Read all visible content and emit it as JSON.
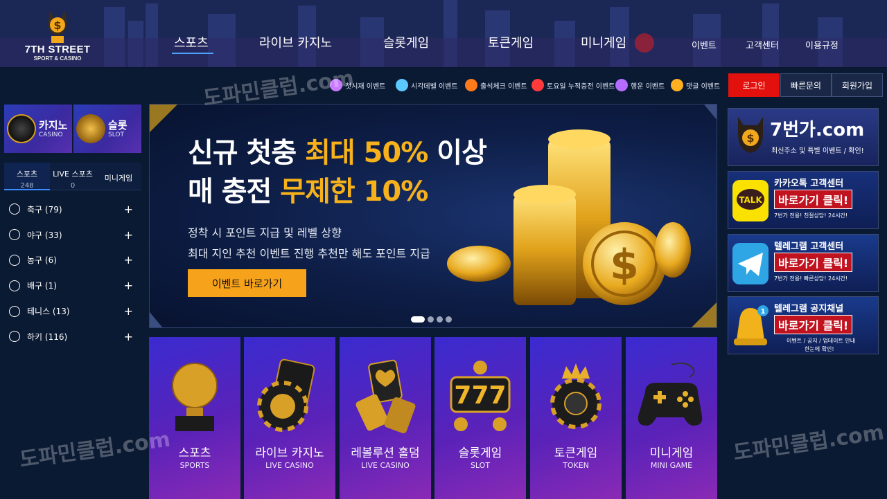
{
  "header": {
    "brand": "7TH STREET",
    "brand_sub": "SPORT & CASINO",
    "main_nav": [
      "스포츠",
      "라이브 카지노",
      "슬롯게임",
      "토큰게임",
      "미니게임"
    ],
    "sub_nav": [
      "이벤트",
      "고객센터",
      "이용규정"
    ]
  },
  "events": [
    {
      "label": "첫시재 이벤트",
      "icon": "rocket-icon",
      "color": "#c87bff"
    },
    {
      "label": "시각데벨 이벤트",
      "icon": "diamond-icon",
      "color": "#59c9ff"
    },
    {
      "label": "출석체크 이벤트",
      "icon": "calendar-icon",
      "color": "#ff7a1a"
    },
    {
      "label": "토요일 누적충전 이벤트",
      "icon": "gift-icon",
      "color": "#ff3b3b"
    },
    {
      "label": "행운 이벤트",
      "icon": "clover-icon",
      "color": "#b56bff"
    },
    {
      "label": "댓글 이벤트",
      "icon": "comment-icon",
      "color": "#ffb020"
    }
  ],
  "auth": {
    "login": "로그인",
    "inquiry": "빠른문의",
    "signup": "회원가입"
  },
  "sidebar": {
    "top_cats": [
      {
        "label": "카지노",
        "sub": "CASINO"
      },
      {
        "label": "슬롯",
        "sub": "SLOT"
      }
    ],
    "tabs": [
      {
        "label": "스포츠",
        "count": "248"
      },
      {
        "label": "LIVE 스포츠",
        "count": "0"
      },
      {
        "label": "미니게임",
        "count": ""
      }
    ],
    "sports": [
      {
        "label": "축구 (79)",
        "icon": "soccer-ball-icon"
      },
      {
        "label": "야구 (33)",
        "icon": "baseball-icon"
      },
      {
        "label": "농구 (6)",
        "icon": "basketball-icon"
      },
      {
        "label": "배구 (1)",
        "icon": "volleyball-icon"
      },
      {
        "label": "테니스 (13)",
        "icon": "tennis-ball-icon"
      },
      {
        "label": "하키 (116)",
        "icon": "hockey-icon"
      }
    ],
    "plus": "+"
  },
  "banner": {
    "line1_a": "신규 첫충 ",
    "line1_b": "최대 50%",
    "line1_c": " 이상",
    "line2_a": "매 충전 ",
    "line2_b": "무제한 10%",
    "desc1": "정착 시 포인트 지급 및 레벨 상향",
    "desc2": "최대 지인 추천 이벤트 진행 추천만 해도 포인트 지급",
    "cta": "이벤트 바로가기",
    "slides": 4,
    "active_slide": 1
  },
  "tiles": [
    {
      "label": "스포츠",
      "sub": "SPORTS",
      "icon": "trophy-icon"
    },
    {
      "label": "라이브 카지노",
      "sub": "LIVE CASINO",
      "icon": "casino-chip-icon"
    },
    {
      "label": "레볼루션 홀덤",
      "sub": "LIVE CASINO",
      "icon": "playing-cards-icon"
    },
    {
      "label": "슬롯게임",
      "sub": "SLOT",
      "icon": "slot-777-icon"
    },
    {
      "label": "토큰게임",
      "sub": "TOKEN",
      "icon": "crown-chip-icon"
    },
    {
      "label": "미니게임",
      "sub": "MINI GAME",
      "icon": "gamepad-icon"
    }
  ],
  "right_banners": {
    "site": {
      "title": "7번가.com",
      "sub": "최신주소 및 특별 이벤트 / 확인!"
    },
    "kakao": {
      "title": "카카오톡 고객센터",
      "cta": "바로가기 클릭!",
      "sub": "7번가 전용! 친절상담! 24시간!",
      "badge": "TALK"
    },
    "telegram": {
      "title": "텔레그램 고객센터",
      "cta": "바로가기 클릭!",
      "sub": "7번가 전용! 빠른상담! 24시간!"
    },
    "notice": {
      "title": "텔레그램 공지채널",
      "cta": "바로가기 클릭!",
      "sub": "이벤트 / 공지 / 업데이트 안내",
      "sub2": "한눈에 확인!",
      "badge": "1"
    }
  },
  "watermark": "도파민클럽.com",
  "colors": {
    "accent_gold": "#f7b21b",
    "login_red": "#e3110d",
    "cta_orange": "#f7a21b",
    "bg": "#0b1a33"
  }
}
